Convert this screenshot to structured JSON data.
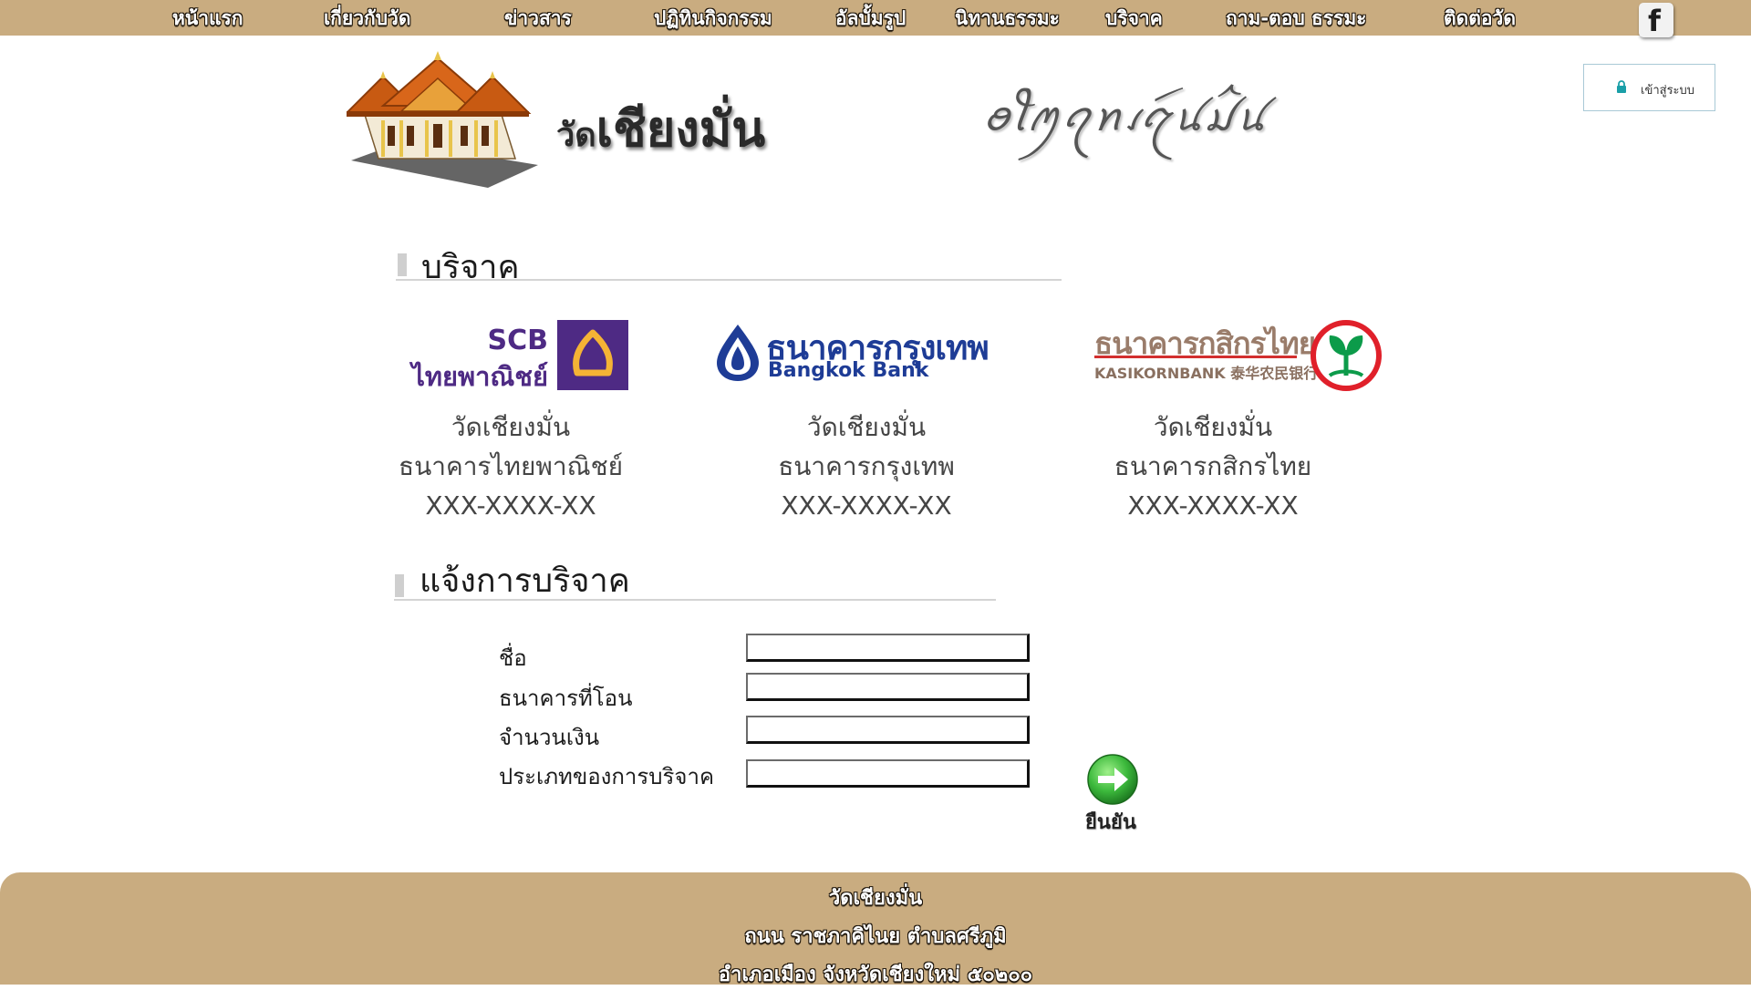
{
  "nav": {
    "items": [
      {
        "label": "หน้าแรก"
      },
      {
        "label": "เกี่ยวกับวัด"
      },
      {
        "label": "ข่าวสาร"
      },
      {
        "label": "ปฏิทินกิจกรรม"
      },
      {
        "label": "อัลบั้มรูป"
      },
      {
        "label": "นิทานธรรมะ"
      },
      {
        "label": "บริจาค"
      },
      {
        "label": "ถาม-ตอบ ธรรมะ"
      },
      {
        "label": "ติดต่อวัด"
      }
    ],
    "facebook_icon": "facebook-icon",
    "facebook_glyph": "f"
  },
  "header": {
    "title_prefix": "วัด",
    "title_main": "เชียงมั่น",
    "lanna_script": "ꪮꪻꪑꪖꪀꪹꪋꪷꪙꪣꪲꪙ",
    "login_label": "เข้าสู่ระบบ",
    "login_icon": "lock-icon"
  },
  "donate": {
    "heading": "บริจาค",
    "banks": [
      {
        "logo_code": "SCB",
        "logo_name": "ไทยพาณิชย์",
        "account_name": "วัดเชียงมั่น",
        "bank_name": "ธนาคารไทยพาณิชย์",
        "account_no": "XXX-XXXX-XX",
        "color": "#4e2a84",
        "accent": "#f5b335"
      },
      {
        "logo_thai": "ธนาคารกรุงเทพ",
        "logo_en": "Bangkok Bank",
        "account_name": "วัดเชียงมั่น",
        "bank_name": "ธนาคารกรุงเทพ",
        "account_no": "XXX-XXXX-XX",
        "color": "#1e3c96"
      },
      {
        "logo_thai": "ธนาคารกสิกรไทย",
        "logo_en": "KASIKORNBANK 泰华农民银行",
        "account_name": "วัดเชียงมั่น",
        "bank_name": "ธนาคารกสิกรไทย",
        "account_no": "XXX-XXXX-XX",
        "color": "#9a7c6a",
        "accent": "#0c9b4a"
      }
    ]
  },
  "notify": {
    "heading": "แจ้งการบริจาค",
    "fields": [
      {
        "label": "ชื่อ",
        "value": ""
      },
      {
        "label": "ธนาคารที่โอน",
        "value": ""
      },
      {
        "label": "จำนวนเงิน",
        "value": ""
      },
      {
        "label": "ประเภทของการบริจาค",
        "value": ""
      }
    ],
    "confirm_label": "ยืนยัน",
    "confirm_icon": "arrow-right-icon"
  },
  "footer": {
    "line1": "วัดเชียงมั่น",
    "line2": "ถนน ราชภาคิไนย ตำบลศรีภูมิ",
    "line3": "อำเภอเมือง จังหวัดเชียงใหม่ ๕๐๒๐๐"
  },
  "colors": {
    "nav_bg": "#c9ac80",
    "footer_bg": "#c9ac80",
    "confirm_green": "#3cb93c"
  }
}
